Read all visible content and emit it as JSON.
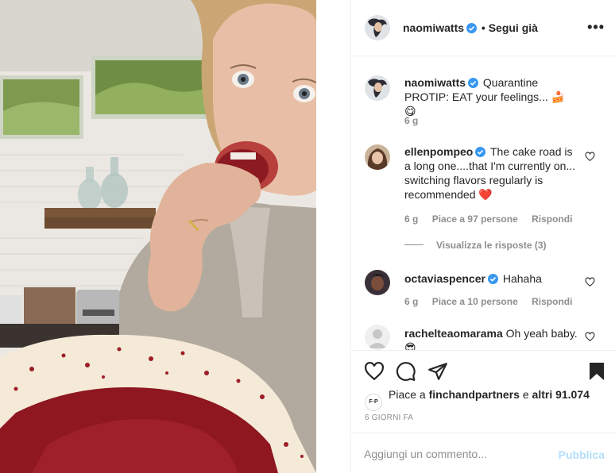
{
  "post": {
    "author": "naomiwatts",
    "follow_label": "• Segui già",
    "more_icon": "more-options-icon",
    "more_glyph": "•••"
  },
  "caption": {
    "author": "naomiwatts",
    "text": "Quarantine PROTIP: EAT your feelings... 🍰 😋",
    "time": "6 g"
  },
  "comments": [
    {
      "author": "ellenpompeo",
      "text": "The cake road is a long one....that I'm currently on... switching flavors regularly is recommended ❤️",
      "time": "6 g",
      "likes": "Piace a 97 persone",
      "reply": "Rispondi",
      "view_replies": "Visualizza le risposte (3)"
    },
    {
      "author": "octaviaspencer",
      "text": "Hahaha",
      "time": "6 g",
      "likes": "Piace a 10 persone",
      "reply": "Rispondi"
    },
    {
      "author": "rachelteaomarama",
      "text": "Oh yeah baby.",
      "second_line": "😎"
    }
  ],
  "likes_line": {
    "prefix": "Piace a ",
    "user": "finchandpartners",
    "middle": " e ",
    "others": "altri 91.074",
    "badge": "F·P"
  },
  "date": "6 GIORNI FA",
  "add_comment": {
    "placeholder": "Aggiungi un commento...",
    "publish": "Pubblica"
  },
  "colors": {
    "verified": "#3897f0",
    "publish_disabled": "#b2dffc",
    "heart_red": "#ed4956"
  }
}
